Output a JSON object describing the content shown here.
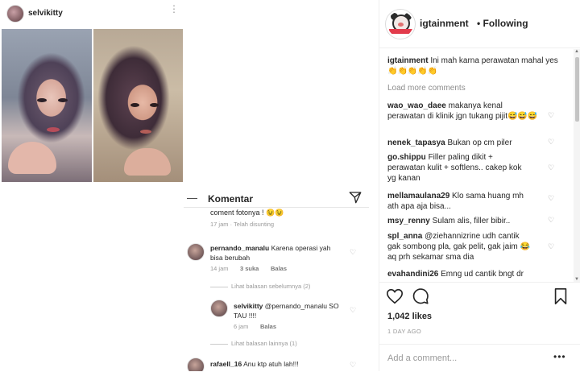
{
  "left": {
    "header": {
      "username": "selvikitty"
    },
    "komentar": {
      "title": "Komentar",
      "cut_text": "coment fotonya ! 😉😉",
      "cut_meta": "17 jam · Telah disunting",
      "c1": {
        "username": "pernando_manalu",
        "text": "Karena operasi yah bisa berubah",
        "time": "14 jam",
        "likes": "3 suka",
        "reply": "Balas"
      },
      "prev_replies": "Lihat balasan sebelumnya (2)",
      "c2": {
        "username": "selvikitty",
        "text": "@pernando_manalu SO TAU !!!!",
        "time": "6 jam",
        "reply": "Balas"
      },
      "other_replies": "Lihat balasan lainnya (1)",
      "c3": {
        "username": "rafaell_16",
        "text": "Anu ktp atuh lah!!!"
      }
    }
  },
  "right": {
    "header": {
      "username": "igtainment",
      "follow_status": "• Following"
    },
    "caption": {
      "username": "igtainment",
      "text": "Ini mah karna perawatan mahal yes 👏👏👏👏👏"
    },
    "load_more": "Load more comments",
    "comments": [
      {
        "username": "wao_wao_daee",
        "text": "makanya kenal perawatan di klinik jgn tukang pijit😅😅😅"
      },
      {
        "username": "nenek_tapasya",
        "text": "Bukan op cm piler"
      },
      {
        "username": "go.shippu",
        "text": "Filler paling dikit + perawatan kulit + softlens.. cakep kok yg kanan"
      },
      {
        "username": "mellamaulana29",
        "text": "Klo sama huang mh ath apa aja bisa..."
      },
      {
        "username": "msy_renny",
        "text": "Sulam alis, filler bibir.."
      },
      {
        "username": "spl_anna",
        "text": "@ziehannizrine udh cantik gak sombong pla, gak pelit, gak jaim 😂 aq prh sekamar sma dia"
      },
      {
        "username": "evahandini26",
        "text": "Emng ud cantik bngt dr"
      }
    ],
    "likes": "1,042 likes",
    "time_ago": "1 DAY AGO",
    "add_comment_placeholder": "Add a comment...",
    "more": "•••"
  }
}
